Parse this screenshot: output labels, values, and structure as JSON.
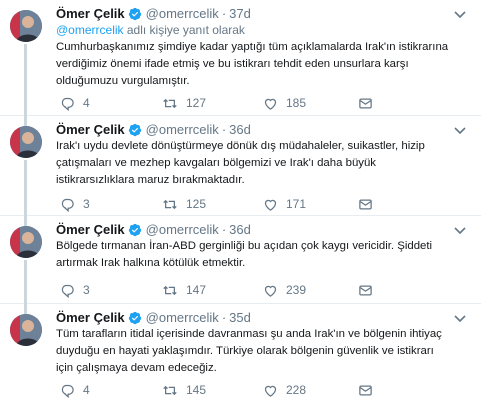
{
  "colors": {
    "accent": "#1da1f2",
    "text": "#14171a",
    "muted": "#657786",
    "divider": "#e6ecf0"
  },
  "tweets": [
    {
      "name": "Ömer Çelik",
      "handle": "@omerrcelik",
      "dot": "·",
      "time": "37d",
      "reply_prefix": "",
      "reply_mention": "@omerrcelik",
      "reply_suffix": " adlı kişiye yanıt olarak",
      "text": "Cumhurbaşkanımız şimdiye kadar yaptığı tüm açıklamalarda Irak'ın istikrarına\nverdiğimiz önemi ifade etmiş ve bu istikrarı tehdit eden unsurlara karşı\nolduğumuzu vurgulamıştır.",
      "replies": "4",
      "retweets": "127",
      "likes": "185"
    },
    {
      "name": "Ömer Çelik",
      "handle": "@omerrcelik",
      "dot": "·",
      "time": "36d",
      "text": "Irak'ı uydu devlete dönüştürmeye dönük dış müdahaleler, suikastler, hizip\nçatışmaları ve mezhep kavgaları bölgemizi ve Irak'ı daha büyük\nistikrarsızlıklara maruz bırakmaktadır.",
      "replies": "3",
      "retweets": "125",
      "likes": "171"
    },
    {
      "name": "Ömer Çelik",
      "handle": "@omerrcelik",
      "dot": "·",
      "time": "36d",
      "text": "Bölgede tırmanan İran-ABD gerginliği bu açıdan çok kaygı vericidir. Şiddeti\nartırmak Irak halkına kötülük etmektir.",
      "replies": "3",
      "retweets": "147",
      "likes": "239"
    },
    {
      "name": "Ömer Çelik",
      "handle": "@omerrcelik",
      "dot": "·",
      "time": "35d",
      "text": "Tüm tarafların itidal içerisinde davranması şu anda Irak'ın ve bölgenin ihtiyaç\nduyduğu en hayati yaklaşımdır. Türkiye olarak bölgenin güvenlik ve istikrarı\niçin çalışmaya devam edeceğiz.",
      "replies": "4",
      "retweets": "145",
      "likes": "228"
    }
  ]
}
